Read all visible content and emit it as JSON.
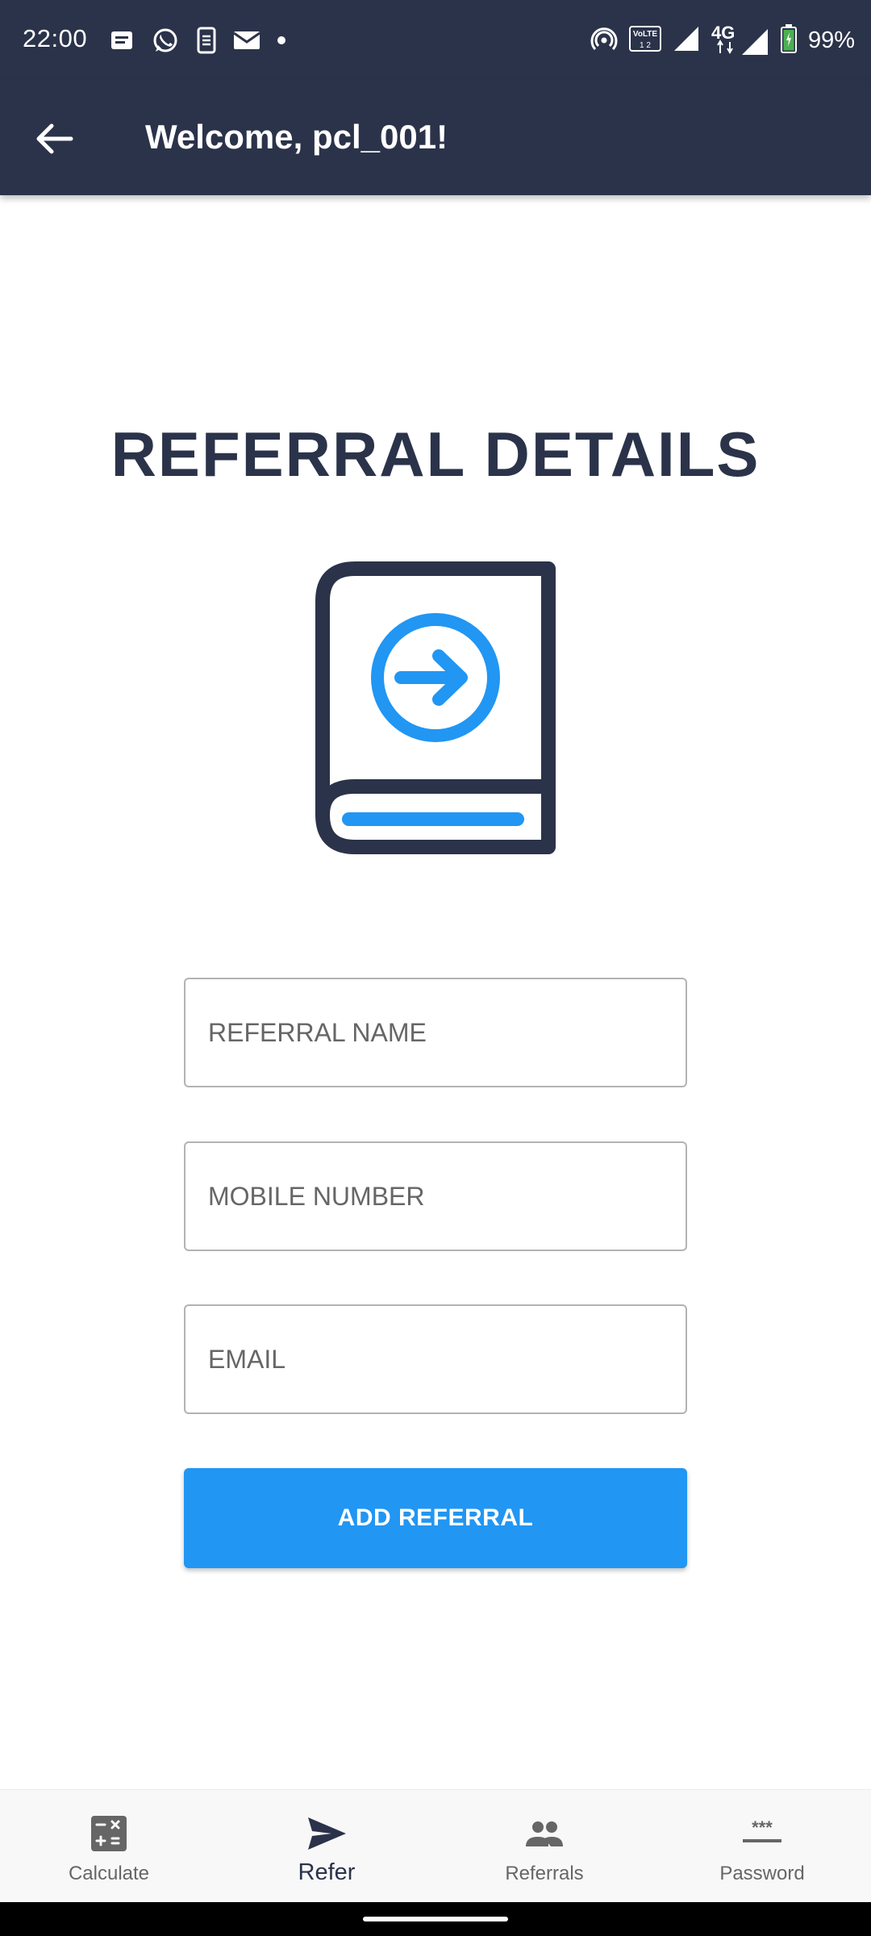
{
  "status_bar": {
    "time": "22:00",
    "battery_percent": "99%",
    "network": "4G",
    "volte": "VoLTE",
    "left_icons": [
      "message-icon",
      "whatsapp-icon",
      "sim-toolkit-icon",
      "mail-icon",
      "dot-icon"
    ],
    "right_icons": [
      "hotspot-icon",
      "volte-icon",
      "signal-icon",
      "signal-4g-icon",
      "battery-icon"
    ]
  },
  "app_bar": {
    "title": "Welcome, pcl_001!",
    "back_icon": "arrow-left-icon"
  },
  "main": {
    "heading": "REFERRAL DETAILS",
    "illustration": "book-arrow-icon",
    "fields": [
      {
        "placeholder": "REFERRAL NAME",
        "value": ""
      },
      {
        "placeholder": "MOBILE NUMBER",
        "value": ""
      },
      {
        "placeholder": "EMAIL",
        "value": ""
      }
    ],
    "submit_label": "ADD REFERRAL"
  },
  "bottom_nav": {
    "items": [
      {
        "label": "Calculate",
        "icon": "calculator-icon",
        "active": false
      },
      {
        "label": "Refer",
        "icon": "send-icon",
        "active": true
      },
      {
        "label": "Referrals",
        "icon": "people-icon",
        "active": false
      },
      {
        "label": "Password",
        "icon": "password-icon",
        "active": false
      }
    ]
  },
  "colors": {
    "primary_dark": "#2b334a",
    "accent": "#2196f3",
    "nav_bg": "#f8f8f8"
  }
}
